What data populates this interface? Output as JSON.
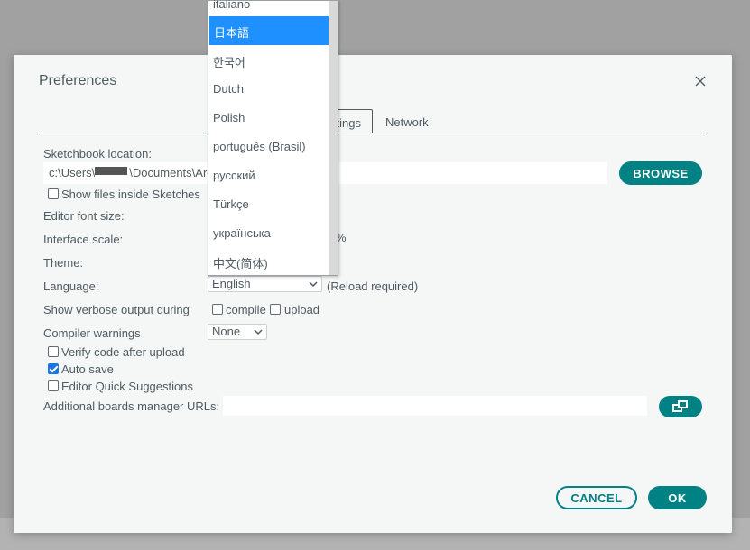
{
  "dialog": {
    "title": "Preferences",
    "tabs": [
      {
        "label": "Settings"
      },
      {
        "label": "Network"
      }
    ],
    "tab_settings_visible": "ttings",
    "sketchbook": {
      "label": "Sketchbook location:",
      "path_visible_start": "c:\\Users\\",
      "path_visible_end": "\\Documents\\Ard",
      "browse_label": "BROWSE"
    },
    "show_files": {
      "label": "Show files inside Sketches",
      "checked": false
    },
    "editor_font_size": {
      "label": "Editor font size:"
    },
    "interface_scale": {
      "label": "Interface scale:",
      "unit": "%"
    },
    "theme": {
      "label": "Theme:"
    },
    "language": {
      "label": "Language:",
      "value": "English",
      "note": "(Reload required)"
    },
    "verbose": {
      "label": "Show verbose output during",
      "compile": "compile",
      "upload": "upload"
    },
    "compiler_warnings": {
      "label": "Compiler warnings",
      "value": "None"
    },
    "verify": {
      "label": "Verify code after upload",
      "checked": false
    },
    "auto_save": {
      "label": "Auto save",
      "checked": true
    },
    "quick_suggestions": {
      "label": "Editor Quick Suggestions",
      "checked": false
    },
    "boards_urls": {
      "label": "Additional boards manager URLs:",
      "value": ""
    },
    "cancel_label": "CANCEL",
    "ok_label": "OK"
  },
  "language_dropdown": {
    "items": [
      {
        "label": "italiano",
        "selected": false
      },
      {
        "label": "日本語",
        "selected": true
      },
      {
        "label": "한국어",
        "selected": false
      },
      {
        "label": "Dutch",
        "selected": false
      },
      {
        "label": "Polish",
        "selected": false
      },
      {
        "label": "português (Brasil)",
        "selected": false
      },
      {
        "label": "русский",
        "selected": false
      },
      {
        "label": "Türkçe",
        "selected": false
      },
      {
        "label": "українська",
        "selected": false
      },
      {
        "label": "中文(简体)",
        "selected": false
      }
    ]
  },
  "colors": {
    "accent": "#008184",
    "selection": "#1e90ff",
    "checkbox_checked": "#1a73e8",
    "text": "#4e5b61",
    "dialog_bg": "#f5f7f7"
  }
}
